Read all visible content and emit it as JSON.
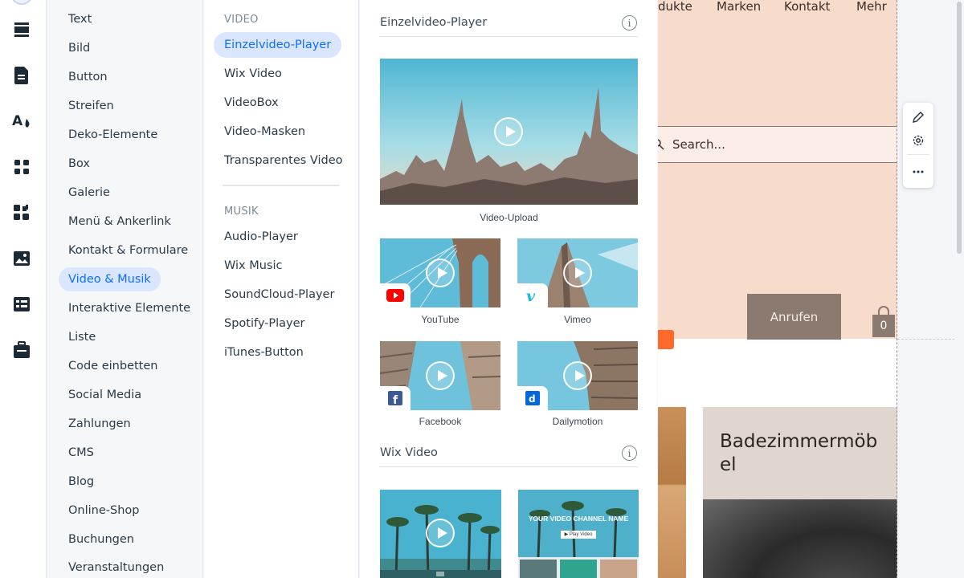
{
  "categories": [
    {
      "label": "Text"
    },
    {
      "label": "Bild"
    },
    {
      "label": "Button"
    },
    {
      "label": "Streifen"
    },
    {
      "label": "Deko-Elemente"
    },
    {
      "label": "Box"
    },
    {
      "label": "Galerie"
    },
    {
      "label": "Menü & Ankerlink"
    },
    {
      "label": "Kontakt & Formulare"
    },
    {
      "label": "Video & Musik",
      "active": true
    },
    {
      "label": "Interaktive Elemente"
    },
    {
      "label": "Liste"
    },
    {
      "label": "Code einbetten"
    },
    {
      "label": "Social Media"
    },
    {
      "label": "Zahlungen"
    },
    {
      "label": "CMS"
    },
    {
      "label": "Blog"
    },
    {
      "label": "Online-Shop"
    },
    {
      "label": "Buchungen"
    },
    {
      "label": "Veranstaltungen"
    }
  ],
  "submenu": {
    "video_heading": "VIDEO",
    "video_items": [
      {
        "label": "Einzelvideo-Player",
        "active": true
      },
      {
        "label": "Wix Video"
      },
      {
        "label": "VideoBox"
      },
      {
        "label": "Video-Masken"
      },
      {
        "label": "Transparentes Video"
      }
    ],
    "music_heading": "MUSIK",
    "music_items": [
      {
        "label": "Audio-Player"
      },
      {
        "label": "Wix Music"
      },
      {
        "label": "SoundCloud-Player"
      },
      {
        "label": "Spotify-Player"
      },
      {
        "label": "iTunes-Button"
      }
    ]
  },
  "preview": {
    "section1_title": "Einzelvideo-Player",
    "main_caption": "Video-Upload",
    "captions": {
      "youtube": "YouTube",
      "vimeo": "Vimeo",
      "facebook": "Facebook",
      "dailymotion": "Dailymotion"
    },
    "section2_title": "Wix Video",
    "channel_title": "YOUR VIDEO CHANNEL NAME",
    "channel_button": "▶ Play Video"
  },
  "site": {
    "nav": [
      "dukte",
      "Marken",
      "Kontakt",
      "Mehr"
    ],
    "search_placeholder": "Search...",
    "call_button": "Anrufen",
    "cart_count": "0",
    "tile_title": "Badezimmermöb el"
  },
  "colors": {
    "accent": "#116dff",
    "header_bg": "#f7dccb",
    "button_bg": "#8a7a70"
  }
}
